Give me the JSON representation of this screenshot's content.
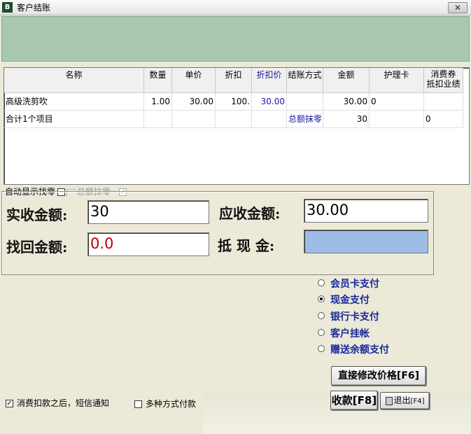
{
  "window": {
    "title": "客户结账",
    "icon_label": "B",
    "close_label": "✕"
  },
  "table": {
    "columns": [
      "名称",
      "数量",
      "单价",
      "折扣",
      "折扣价",
      "结账方式",
      "金额",
      "护理卡",
      "消费券\n抵扣业绩"
    ],
    "rows": [
      [
        "高级洗剪吹",
        "1.00",
        "30.00",
        "100.",
        "30.00",
        "",
        "30.00",
        "0",
        ""
      ],
      [
        "合计1个项目",
        "",
        "",
        "",
        "",
        "总额抹零",
        "30",
        "",
        "0"
      ]
    ]
  },
  "options": {
    "auto_show_change_label": "自动显示找零",
    "auto_show_change_checked": false,
    "round_total_label": "总额抹零",
    "round_total_checked": true
  },
  "payment": {
    "actual_received_label": "实收金额:",
    "actual_received_value": "30",
    "receivable_label": "应收金额:",
    "receivable_value": "30.00",
    "change_label": "找回金额:",
    "change_value": "0.0",
    "offset_cash_label": "抵 现 金:",
    "offset_cash_value": ""
  },
  "pay_methods": [
    {
      "label": "会员卡支付",
      "selected": false
    },
    {
      "label": "现金支付",
      "selected": true
    },
    {
      "label": "银行卡支付",
      "selected": false
    },
    {
      "label": "客户挂帐",
      "selected": false
    },
    {
      "label": "赠送余额支付",
      "selected": false
    }
  ],
  "buttons": {
    "modify_price": "直接修改价格[F6]",
    "checkout": "收款[F8]",
    "exit_main": "退出",
    "exit_key": "[F4]"
  },
  "footer": {
    "sms_notify_label": "消费扣款之后，短信通知",
    "sms_notify_checked": true,
    "multi_pay_label": "多种方式付款",
    "multi_pay_checked": false
  },
  "colors": {
    "banner": "#a8c8b0",
    "offset_field": "#9dbde6",
    "change_text": "#c00000",
    "radio_text": "#1a2a9a"
  }
}
